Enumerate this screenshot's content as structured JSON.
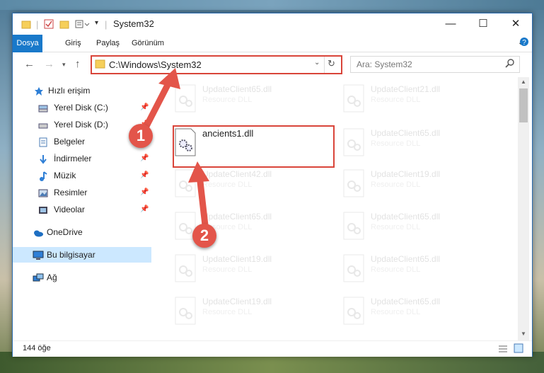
{
  "window": {
    "title": "System32",
    "controls": {
      "minimize": "—",
      "maximize": "☐",
      "close": "✕"
    }
  },
  "ribbon": {
    "tabs": [
      "Dosya",
      "Giriş",
      "Paylaş",
      "Görünüm"
    ]
  },
  "address": {
    "path": "C:\\Windows\\System32",
    "search_placeholder": "Ara: System32"
  },
  "sidebar": {
    "items": [
      {
        "label": "Hızlı erişim",
        "icon": "star-icon",
        "pinned": false
      },
      {
        "label": "Yerel Disk (C:)",
        "icon": "drive-icon",
        "pinned": true
      },
      {
        "label": "Yerel Disk (D:)",
        "icon": "drive-icon",
        "pinned": true
      },
      {
        "label": "Belgeler",
        "icon": "documents-icon",
        "pinned": true
      },
      {
        "label": "İndirmeler",
        "icon": "download-icon",
        "pinned": true
      },
      {
        "label": "Müzik",
        "icon": "music-icon",
        "pinned": true
      },
      {
        "label": "Resimler",
        "icon": "pictures-icon",
        "pinned": true
      },
      {
        "label": "Videolar",
        "icon": "videos-icon",
        "pinned": true
      },
      {
        "label": "OneDrive",
        "icon": "cloud-icon",
        "pinned": false
      },
      {
        "label": "Bu bilgisayar",
        "icon": "computer-icon",
        "pinned": false,
        "selected": true
      },
      {
        "label": "Ağ",
        "icon": "network-icon",
        "pinned": false
      }
    ]
  },
  "files": [
    {
      "name": "UpdateClient65.dll",
      "type": "Resource DLL",
      "faded": true
    },
    {
      "name": "UpdateClient21.dll",
      "type": "Resource DLL",
      "faded": true
    },
    {
      "name": "ancients1.dll",
      "type": "",
      "faded": false,
      "highlighted": true
    },
    {
      "name": "UpdateClient65.dll",
      "type": "Resource DLL",
      "faded": true
    },
    {
      "name": "UpdateClient42.dll",
      "type": "Resource DLL",
      "faded": true
    },
    {
      "name": "UpdateClient19.dll",
      "type": "Resource DLL",
      "faded": true
    },
    {
      "name": "UpdateClient65.dll",
      "type": "Resource DLL",
      "faded": true
    },
    {
      "name": "UpdateClient65.dll",
      "type": "Resource DLL",
      "faded": true
    },
    {
      "name": "UpdateClient19.dll",
      "type": "Resource DLL",
      "faded": true
    },
    {
      "name": "UpdateClient65.dll",
      "type": "Resource DLL",
      "faded": true
    },
    {
      "name": "UpdateClient19.dll",
      "type": "Resource DLL",
      "faded": true
    },
    {
      "name": "UpdateClient65.dll",
      "type": "Resource DLL",
      "faded": true
    }
  ],
  "status": {
    "item_count": "144 öğe"
  },
  "annotations": {
    "step1": "1",
    "step2": "2",
    "color": "#e3554a"
  }
}
